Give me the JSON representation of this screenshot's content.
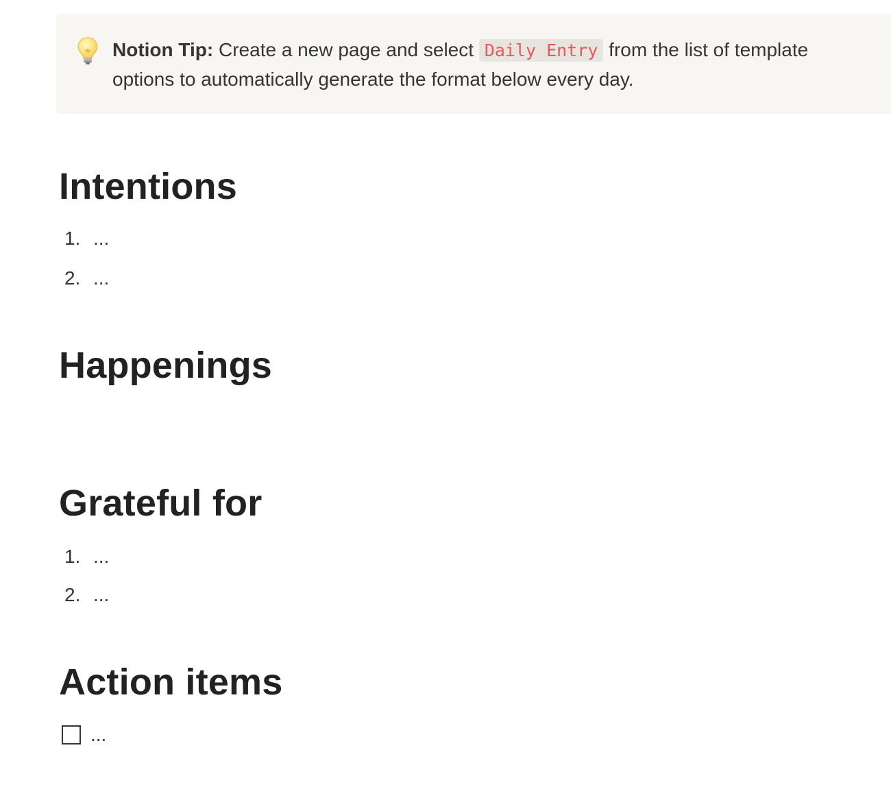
{
  "callout": {
    "icon": "lightbulb-icon",
    "bold_prefix": "Notion Tip:",
    "text_before": " Create a new page and select ",
    "code": "Daily Entry",
    "text_after": " from the list of template options to automatically generate the format below every day."
  },
  "sections": {
    "intentions": {
      "heading": "Intentions",
      "items": [
        {
          "num": "1.",
          "text": "..."
        },
        {
          "num": "2.",
          "text": "..."
        }
      ]
    },
    "happenings": {
      "heading": "Happenings"
    },
    "grateful": {
      "heading": "Grateful for",
      "items": [
        {
          "num": "1.",
          "text": "..."
        },
        {
          "num": "2.",
          "text": "..."
        }
      ]
    },
    "actions": {
      "heading": "Action items",
      "todo": {
        "checked": false,
        "text": "..."
      }
    }
  },
  "colors": {
    "callout_bg": "#f7f6f3",
    "code_text": "#eb5757",
    "heading": "#222222",
    "body_text": "#37352f"
  }
}
